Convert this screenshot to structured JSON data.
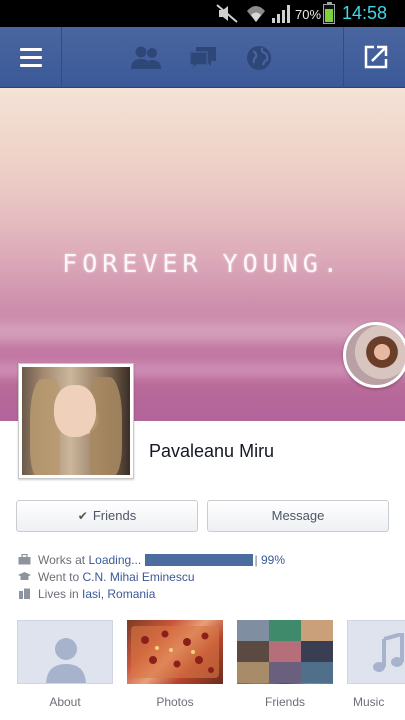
{
  "status_bar": {
    "battery_percent": "70%",
    "battery_level": 0.7,
    "time": "14:58",
    "icons": [
      "mute-icon",
      "wifi-icon",
      "signal-icon",
      "battery-icon"
    ]
  },
  "nav": {
    "icons": [
      "menu-icon",
      "friend-requests-icon",
      "messages-icon",
      "notifications-globe-icon",
      "share-icon"
    ],
    "color": "#3b5998"
  },
  "cover": {
    "text": "FOREVER YOUNG."
  },
  "profile": {
    "name": "Pavaleanu Miru"
  },
  "actions": {
    "friends_label": "Friends",
    "message_label": "Message"
  },
  "info": {
    "work_prefix": "Works at",
    "work_place": "Loading...",
    "work_bar_end": "|",
    "work_percent": "99%",
    "work_progress": 0.99,
    "school_prefix": "Went to",
    "school": "C.N. Mihai Eminescu",
    "home_prefix": "Lives in",
    "home": "Iasi, Romania"
  },
  "tiles": {
    "about": "About",
    "photos": "Photos",
    "friends": "Friends",
    "music": "Music"
  }
}
